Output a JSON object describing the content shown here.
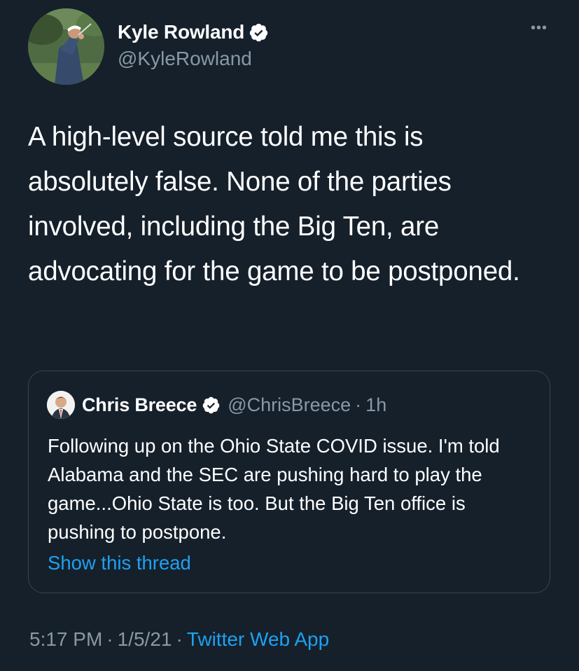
{
  "author": {
    "display_name": "Kyle Rowland",
    "handle": "@KyleRowland",
    "verified": true
  },
  "more_menu_label": "•••",
  "tweet": {
    "text": "A high-level source told me this is absolutely false. None of the parties involved, including the Big Ten, are advocating for the game to be postponed."
  },
  "quoted_tweet": {
    "display_name": "Chris Breece",
    "handle": "@ChrisBreece",
    "separator": "·",
    "time": "1h",
    "verified": true,
    "text": "Following up on the Ohio State COVID issue. I'm told Alabama and the SEC are pushing hard to play the game...Ohio State is too. But the Big Ten office is pushing to postpone.",
    "show_thread_label": "Show this thread"
  },
  "metadata": {
    "time": "5:17 PM",
    "separator": "·",
    "date": "1/5/21",
    "source": "Twitter Web App"
  },
  "colors": {
    "background": "#15202b",
    "secondary_text": "#8899a6",
    "link": "#1da1f2",
    "border": "#38444d",
    "verified_badge": "#ffffff"
  },
  "icons": {
    "verified": "verified-badge-icon",
    "more": "more-options-icon"
  }
}
